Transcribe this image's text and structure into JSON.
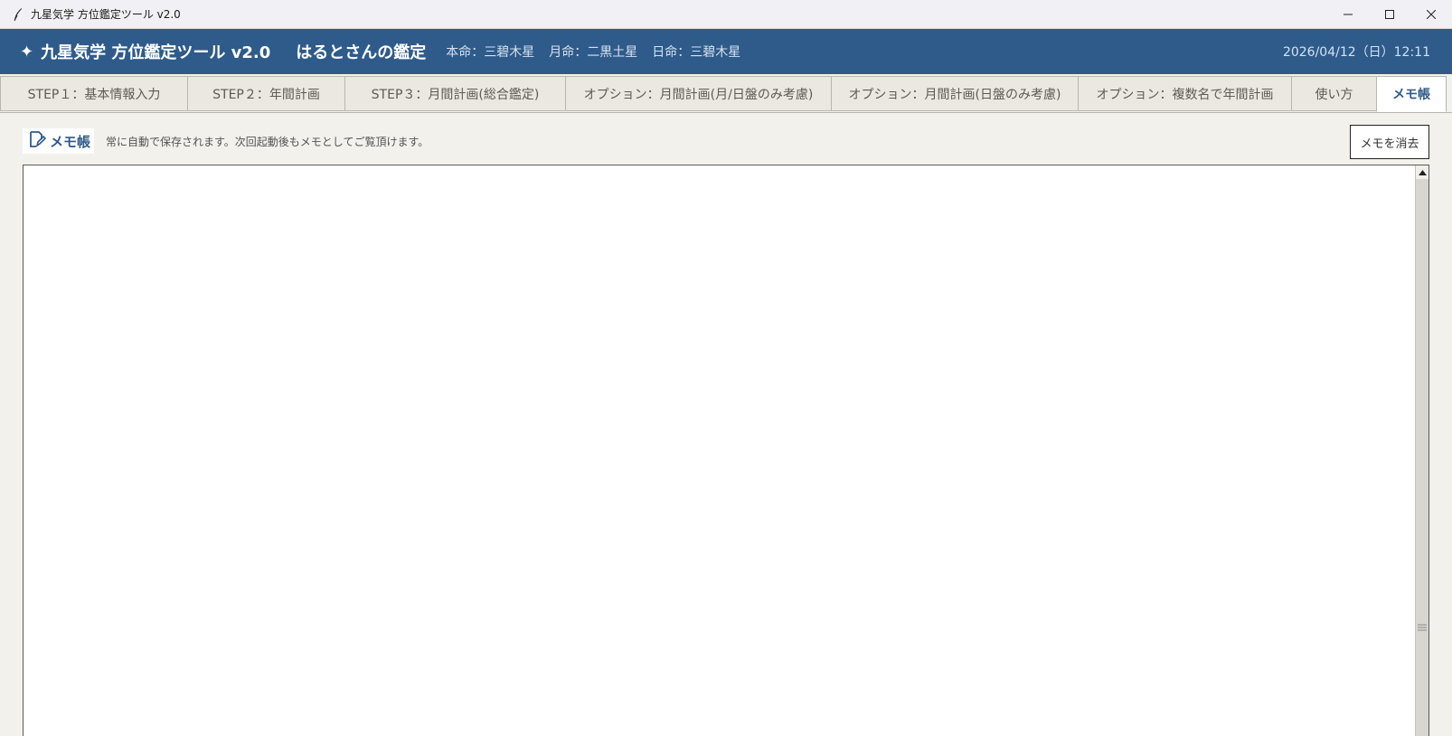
{
  "window": {
    "title": "九星気学 方位鑑定ツール v2.0"
  },
  "header": {
    "star": "✦",
    "app_name": "九星気学 方位鑑定ツール v2.0",
    "client": "はるとさんの鑑定",
    "honmei": "本命：三碧木星",
    "getsumei": "月命：二黒土星",
    "nichimei": "日命：三碧木星",
    "datetime": "2026/04/12（日）12:11"
  },
  "tabs": [
    {
      "label": "STEP１：基本情報入力"
    },
    {
      "label": "STEP２：年間計画"
    },
    {
      "label": "STEP３：月間計画(総合鑑定)"
    },
    {
      "label": "オプション：月間計画(月/日盤のみ考慮)"
    },
    {
      "label": "オプション：月間計画(日盤のみ考慮)"
    },
    {
      "label": "オプション：複数名で年間計画"
    },
    {
      "label": "使い方"
    },
    {
      "label": "メモ帳"
    }
  ],
  "memo": {
    "label": "メモ帳",
    "note": "常に自動で保存されます。次回起動後もメモとしてご覧頂けます。",
    "clear_button": "メモを消去",
    "content": ""
  },
  "colors": {
    "header_bg": "#2f5b8b",
    "accent": "#2f5b8b"
  }
}
